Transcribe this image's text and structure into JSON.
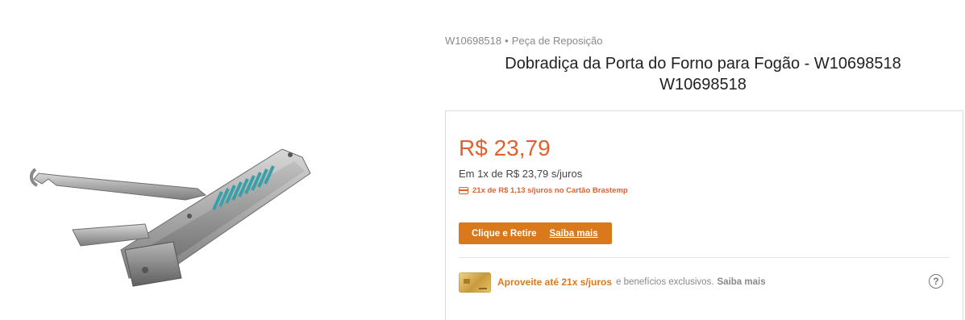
{
  "product": {
    "sku": "W10698518",
    "separator": "•",
    "category": "Peça de Reposição",
    "title_line1": "Dobradiça da Porta do Forno para Fogão - W10698518",
    "title_line2": "W10698518",
    "image_alt": "Dobradiça da Porta do Forno"
  },
  "pricing": {
    "price": "R$ 23,79",
    "installment": "Em 1x de R$ 23,79 s/juros",
    "card_offer": "21x de R$ 1,13 s/juros no Cartão Brastemp"
  },
  "pickup": {
    "label": "Clique e Retire",
    "learn_more": "Saiba mais"
  },
  "benefit": {
    "highlight": "Aproveite até 21x s/juros",
    "text": "e benefícios exclusivos.",
    "learn_more": "Saiba mais",
    "help": "?"
  },
  "colors": {
    "accent_price": "#e0612d",
    "button_orange": "#d9791c"
  },
  "icons": [
    "card-icon",
    "gold-card-icon",
    "help-icon"
  ]
}
